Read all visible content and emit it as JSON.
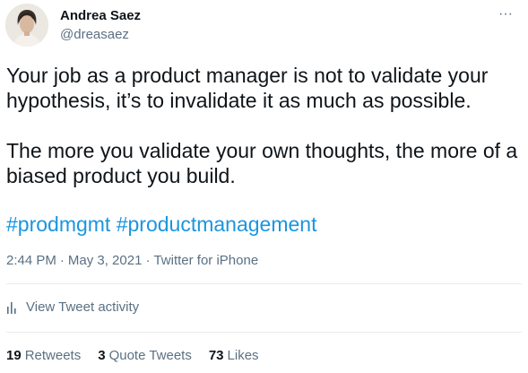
{
  "author": {
    "name": "Andrea Saez",
    "handle": "@dreasaez"
  },
  "tweet": {
    "paragraph_1": "Your job as a product manager is not to validate your hypothesis, it’s to invalidate it as much as possible.",
    "paragraph_2": "The more you validate your own thoughts, the more of a biased product you build.",
    "hashtags": [
      "#prodmgmt",
      "#productmanagement"
    ]
  },
  "meta": {
    "time": "2:44 PM",
    "date": "May 3, 2021",
    "source": "Twitter for iPhone",
    "separator": "·"
  },
  "activity": {
    "label": "View Tweet activity",
    "icon": "bar-chart-icon"
  },
  "stats": {
    "retweets": {
      "count": "19",
      "label": "Retweets"
    },
    "quote_tweets": {
      "count": "3",
      "label": "Quote Tweets"
    },
    "likes": {
      "count": "73",
      "label": "Likes"
    }
  },
  "more_menu": {
    "icon": "more-icon",
    "glyph": "···"
  },
  "colors": {
    "text": "#0f1419",
    "secondary": "#5b7083",
    "link": "#1b95e0",
    "divider": "#e6ecf0"
  }
}
